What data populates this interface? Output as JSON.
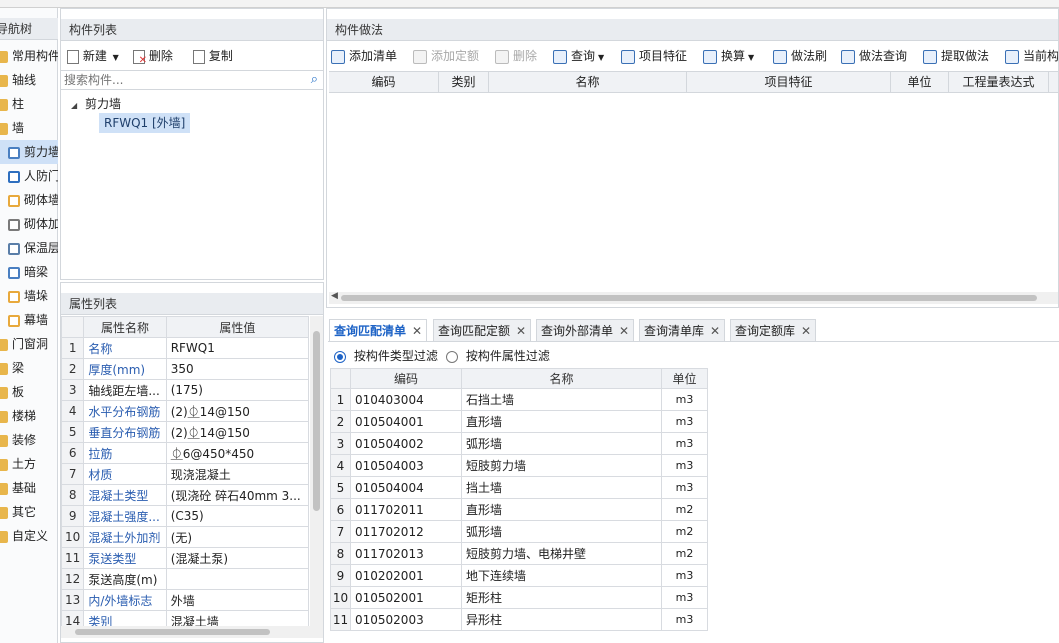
{
  "nav": {
    "title": "导航树",
    "items": [
      {
        "label": "常用构件",
        "icon": "folder-icon",
        "color": "#e8b64c",
        "indent": false
      },
      {
        "label": "轴线",
        "icon": "folder-icon",
        "color": "#e8b64c",
        "indent": false
      },
      {
        "label": "柱",
        "icon": "folder-icon",
        "color": "#e8b64c",
        "indent": false
      },
      {
        "label": "墙",
        "icon": "folder-icon",
        "color": "#e8b64c",
        "indent": false
      },
      {
        "label": "剪力墙",
        "icon": "shear-wall-icon",
        "color": "#4a7fc1",
        "indent": true,
        "selected": true
      },
      {
        "label": "人防门",
        "icon": "door-icon",
        "color": "#2e6fbf",
        "indent": true
      },
      {
        "label": "砌体墙",
        "icon": "brick-icon",
        "color": "#e8a93c",
        "indent": true
      },
      {
        "label": "砌体加筋",
        "icon": "rebar-icon",
        "color": "#7a7a7a",
        "indent": true
      },
      {
        "label": "保温层",
        "icon": "insulation-icon",
        "color": "#5a7ea8",
        "indent": true
      },
      {
        "label": "暗梁",
        "icon": "hidden-beam-icon",
        "color": "#4a7fc1",
        "indent": true
      },
      {
        "label": "墙垛",
        "icon": "wall-pier-icon",
        "color": "#e8a93c",
        "indent": true
      },
      {
        "label": "幕墙",
        "icon": "curtain-wall-icon",
        "color": "#e8a93c",
        "indent": true
      },
      {
        "label": "门窗洞",
        "icon": "folder-icon",
        "color": "#e8b64c",
        "indent": false
      },
      {
        "label": "梁",
        "icon": "folder-icon",
        "color": "#e8b64c",
        "indent": false
      },
      {
        "label": "板",
        "icon": "folder-icon",
        "color": "#e8b64c",
        "indent": false
      },
      {
        "label": "楼梯",
        "icon": "folder-icon",
        "color": "#e8b64c",
        "indent": false
      },
      {
        "label": "装修",
        "icon": "folder-icon",
        "color": "#e8b64c",
        "indent": false
      },
      {
        "label": "土方",
        "icon": "folder-icon",
        "color": "#e8b64c",
        "indent": false
      },
      {
        "label": "基础",
        "icon": "folder-icon",
        "color": "#e8b64c",
        "indent": false
      },
      {
        "label": "其它",
        "icon": "folder-icon",
        "color": "#e8b64c",
        "indent": false
      },
      {
        "label": "自定义",
        "icon": "folder-icon",
        "color": "#e8b64c",
        "indent": false
      }
    ]
  },
  "component_list": {
    "title": "构件列表",
    "new_label": "新建",
    "delete_label": "删除",
    "copy_label": "复制",
    "search_placeholder": "搜索构件...",
    "tree_group": "剪力墙",
    "tree_item": "RFWQ1 [外墙]"
  },
  "properties": {
    "title": "属性列表",
    "col_name": "属性名称",
    "col_value": "属性值",
    "rows": [
      {
        "n": "1",
        "k": "名称",
        "v": "RFWQ1",
        "blue": true
      },
      {
        "n": "2",
        "k": "厚度(mm)",
        "v": "350",
        "blue": true
      },
      {
        "n": "3",
        "k": "轴线距左墙...",
        "v": "(175)",
        "blue": false
      },
      {
        "n": "4",
        "k": "水平分布钢筋",
        "v": "(2)⏂14@150",
        "blue": true
      },
      {
        "n": "5",
        "k": "垂直分布钢筋",
        "v": "(2)⏂14@150",
        "blue": true
      },
      {
        "n": "6",
        "k": "拉筋",
        "v": "⏂6@450*450",
        "blue": true
      },
      {
        "n": "7",
        "k": "材质",
        "v": "现浇混凝土",
        "blue": true
      },
      {
        "n": "8",
        "k": "混凝土类型",
        "v": "(现浇砼 碎石40mm 3...",
        "blue": true
      },
      {
        "n": "9",
        "k": "混凝土强度...",
        "v": "(C35)",
        "blue": true
      },
      {
        "n": "10",
        "k": "混凝土外加剂",
        "v": "(无)",
        "blue": true
      },
      {
        "n": "11",
        "k": "泵送类型",
        "v": "(混凝土泵)",
        "blue": true
      },
      {
        "n": "12",
        "k": "泵送高度(m)",
        "v": "",
        "blue": false
      },
      {
        "n": "13",
        "k": "内/外墙标志",
        "v": "外墙",
        "blue": true
      },
      {
        "n": "14",
        "k": "类别",
        "v": "混凝土墙",
        "blue": true
      }
    ]
  },
  "method": {
    "title": "构件做法",
    "toolbar": [
      {
        "label": "添加清单",
        "icon": "add-list-icon",
        "enabled": true
      },
      {
        "label": "添加定额",
        "icon": "add-quota-icon",
        "enabled": false
      },
      {
        "label": "删除",
        "icon": "delete-icon",
        "enabled": false
      },
      {
        "label": "查询",
        "icon": "query-icon",
        "enabled": true,
        "dropdown": true
      },
      {
        "label": "项目特征",
        "icon": "feature-icon",
        "enabled": true
      },
      {
        "label": "换算",
        "icon": "fx-icon",
        "enabled": true,
        "dropdown": true
      },
      {
        "label": "做法刷",
        "icon": "brush-icon",
        "enabled": true
      },
      {
        "label": "做法查询",
        "icon": "method-query-icon",
        "enabled": true
      },
      {
        "label": "提取做法",
        "icon": "extract-icon",
        "enabled": true
      },
      {
        "label": "当前构",
        "icon": "current-icon",
        "enabled": true
      }
    ],
    "columns": [
      "编码",
      "类别",
      "名称",
      "项目特征",
      "单位",
      "工程量表达式"
    ]
  },
  "query": {
    "tabs": [
      "查询匹配清单",
      "查询匹配定额",
      "查询外部清单",
      "查询清单库",
      "查询定额库"
    ],
    "filter_type": "按构件类型过滤",
    "filter_attr": "按构件属性过滤",
    "columns": [
      "编码",
      "名称",
      "单位"
    ],
    "rows": [
      {
        "n": "1",
        "code": "010403004",
        "name": "石挡土墙",
        "unit": "m3"
      },
      {
        "n": "2",
        "code": "010504001",
        "name": "直形墙",
        "unit": "m3"
      },
      {
        "n": "3",
        "code": "010504002",
        "name": "弧形墙",
        "unit": "m3"
      },
      {
        "n": "4",
        "code": "010504003",
        "name": "短肢剪力墙",
        "unit": "m3"
      },
      {
        "n": "5",
        "code": "010504004",
        "name": "挡土墙",
        "unit": "m3"
      },
      {
        "n": "6",
        "code": "011702011",
        "name": "直形墙",
        "unit": "m2"
      },
      {
        "n": "7",
        "code": "011702012",
        "name": "弧形墙",
        "unit": "m2"
      },
      {
        "n": "8",
        "code": "011702013",
        "name": "短肢剪力墙、电梯井壁",
        "unit": "m2"
      },
      {
        "n": "9",
        "code": "010202001",
        "name": "地下连续墙",
        "unit": "m3"
      },
      {
        "n": "10",
        "code": "010502001",
        "name": "矩形柱",
        "unit": "m3"
      },
      {
        "n": "11",
        "code": "010502003",
        "name": "异形柱",
        "unit": "m3"
      }
    ]
  }
}
